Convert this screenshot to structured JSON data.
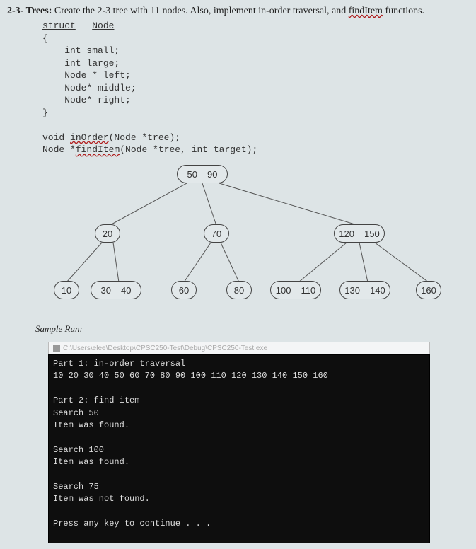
{
  "problem": {
    "prefix": "2-3- Trees:",
    "body_before": " Create the 2-3 tree with 11 nodes. Also, implement in-order traversal, and ",
    "find_item": "findItem",
    "body_after": " functions."
  },
  "code": {
    "l1a": "struct",
    "l1b": "Node",
    "l2": "{",
    "l3": "    int small;",
    "l4": "    int large;",
    "l5": "    Node * left;",
    "l6": "    Node* middle;",
    "l7": "    Node* right;",
    "l8": "}",
    "l9a": "void ",
    "l9b": "inOrder",
    "l9c": "(Node *tree);",
    "l10a": "Node *",
    "l10b": "findItem",
    "l10c": "(Node *tree, int target);"
  },
  "tree": {
    "root_a": "50",
    "root_b": "90",
    "n20": "20",
    "n70": "70",
    "n120": "120",
    "n150": "150",
    "n10": "10",
    "n30": "30",
    "n40": "40",
    "n60": "60",
    "n80": "80",
    "n100": "100",
    "n110": "110",
    "n130": "130",
    "n140": "140",
    "n160": "160"
  },
  "sample_label": "Sample Run:",
  "console_title": "C:\\Users\\elee\\Desktop\\CPSC250-Test\\Debug\\CPSC250-Test.exe",
  "console": {
    "p1h": "Part 1: in-order traversal",
    "p1d": "10 20 30 40 50 60 70 80 90 100 110 120 130 140 150 160",
    "p2h": "Part 2: find item",
    "s50": "Search 50",
    "f1": "Item was found.",
    "s100": "Search 100",
    "f2": "Item was found.",
    "s75": "Search 75",
    "nf": "Item was not found.",
    "cont": "Press any key to continue . . ."
  }
}
